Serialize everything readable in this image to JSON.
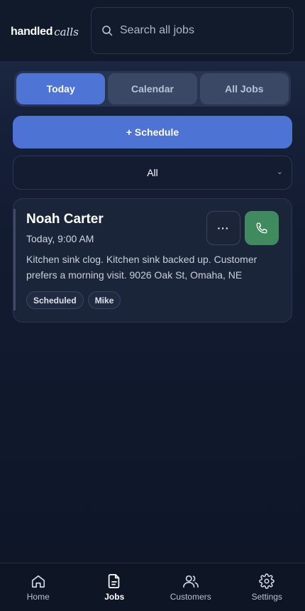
{
  "brand": {
    "bold": "handled",
    "script": "calls"
  },
  "search": {
    "placeholder": "Search all jobs"
  },
  "tabs": [
    {
      "label": "Today",
      "active": true
    },
    {
      "label": "Calendar",
      "active": false
    },
    {
      "label": "All Jobs",
      "active": false
    }
  ],
  "schedule_button": {
    "label": "+ Schedule"
  },
  "filter": {
    "value": "All"
  },
  "jobs": [
    {
      "name": "Noah Carter",
      "time": "Today, 9:00 AM",
      "description": "Kitchen sink clog. Kitchen sink backed up. Customer prefers a morning visit. 9026 Oak St, Omaha, NE",
      "tags": [
        "Scheduled",
        "Mike"
      ],
      "more_label": "···"
    }
  ],
  "nav": [
    {
      "label": "Home",
      "icon": "home-icon",
      "active": false
    },
    {
      "label": "Jobs",
      "icon": "document-icon",
      "active": true
    },
    {
      "label": "Customers",
      "icon": "users-icon",
      "active": false
    },
    {
      "label": "Settings",
      "icon": "gear-icon",
      "active": false
    }
  ],
  "colors": {
    "accent": "#4d73d5",
    "call_green": "#3f8a5e",
    "background": "#0f1728"
  }
}
